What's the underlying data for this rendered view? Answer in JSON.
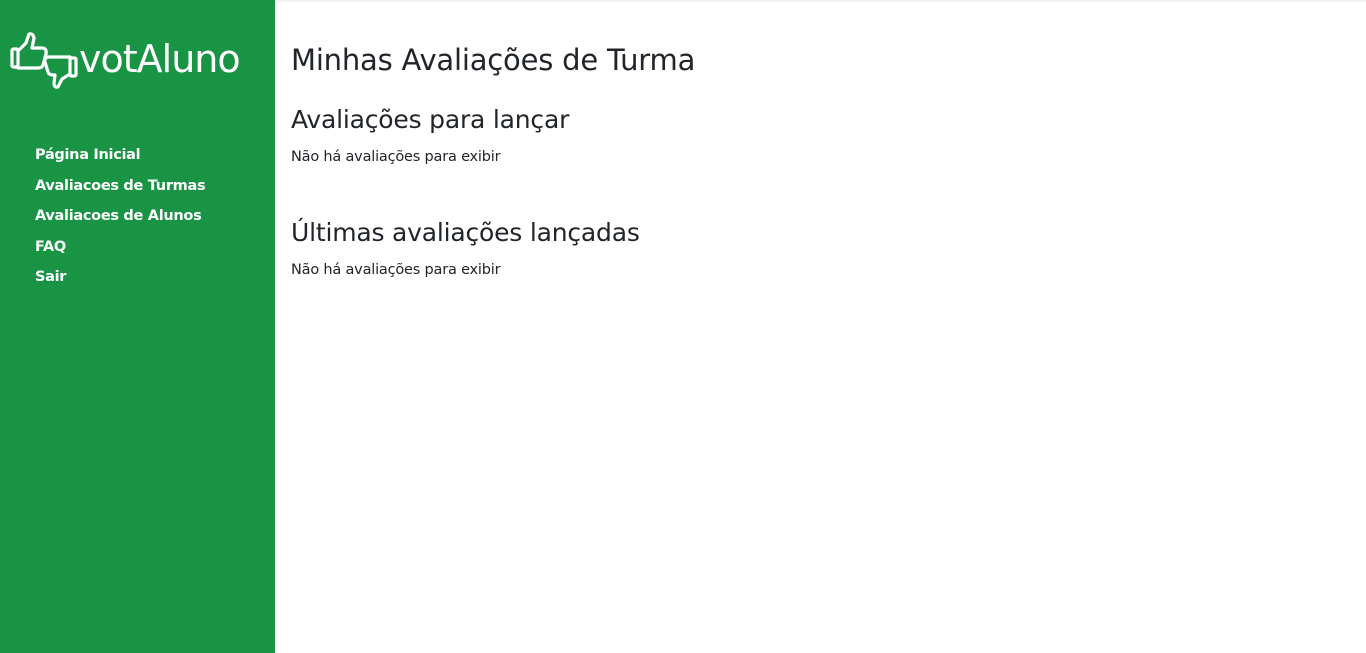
{
  "sidebar": {
    "brand": {
      "icon": "thumbs-up-down-icon",
      "text": "votAluno"
    },
    "nav": [
      {
        "label": "Página Inicial"
      },
      {
        "label": "Avaliacoes de Turmas"
      },
      {
        "label": "Avaliacoes de Alunos"
      },
      {
        "label": "FAQ"
      },
      {
        "label": "Sair"
      }
    ],
    "background_color": "#189444"
  },
  "main": {
    "title": "Minhas Avaliações de Turma",
    "sections": [
      {
        "title": "Avaliações para lançar",
        "empty_message": "Não há avaliações para exibir"
      },
      {
        "title": "Últimas avaliações lançadas",
        "empty_message": "Não há avaliações para exibir"
      }
    ]
  }
}
